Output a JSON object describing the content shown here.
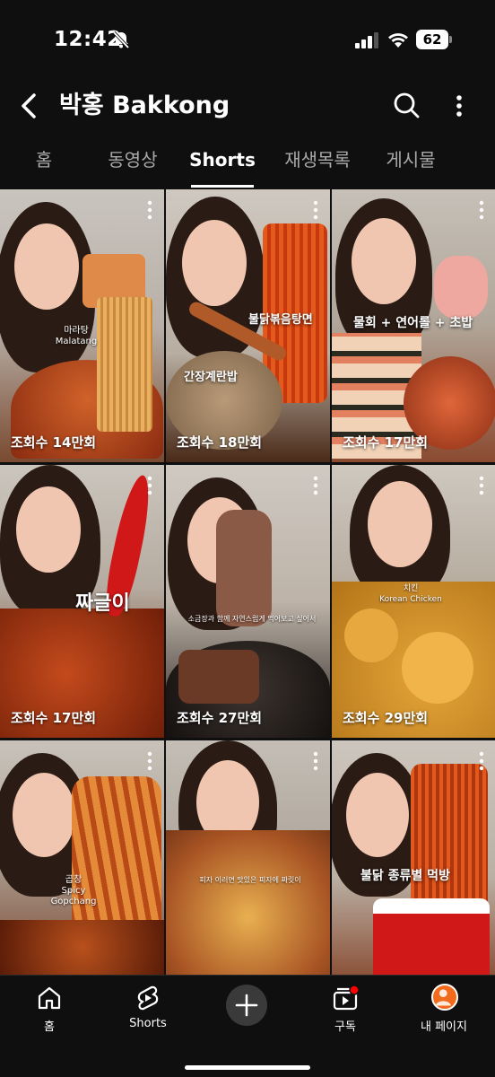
{
  "status": {
    "time": "12:42",
    "battery": "62"
  },
  "header": {
    "title": "박홍 Bakkong"
  },
  "tabs": [
    {
      "label": "홈"
    },
    {
      "label": "동영상"
    },
    {
      "label": "Shorts"
    },
    {
      "label": "재생목록"
    },
    {
      "label": "게시물"
    }
  ],
  "videos": [
    {
      "views": "조회수 14만회",
      "caption": "마라탕\nMalatang"
    },
    {
      "views": "조회수 18만회",
      "caption": "불닭볶음탕면",
      "caption2": "간장계란밥"
    },
    {
      "views": "조회수 17만회",
      "caption": "물회 + 연어롤 + 초밥"
    },
    {
      "views": "조회수 17만회",
      "caption": "짜글이"
    },
    {
      "views": "조회수 27만회",
      "caption": "소금장과 함께 자연스럽게 먹어보고 싶어서"
    },
    {
      "views": "조회수 29만회",
      "caption": "치킨\nKorean Chicken"
    },
    {
      "views": "",
      "caption": "곱창\nSpicy Gopchang"
    },
    {
      "views": "",
      "caption": "피자 이러면 맛있은 피자에 짜릿이"
    },
    {
      "views": "",
      "caption": "불닭 종류별 먹방"
    }
  ],
  "nav": [
    {
      "label": "홈",
      "icon": "home-icon"
    },
    {
      "label": "Shorts",
      "icon": "shorts-icon"
    },
    {
      "label": "",
      "icon": "create-icon"
    },
    {
      "label": "구독",
      "icon": "subscriptions-icon"
    },
    {
      "label": "내 페이지",
      "icon": "profile-icon"
    }
  ],
  "colors": {
    "background": "#0f0f0f",
    "notification": "#ff0000",
    "avatar": "#f26a1c"
  }
}
